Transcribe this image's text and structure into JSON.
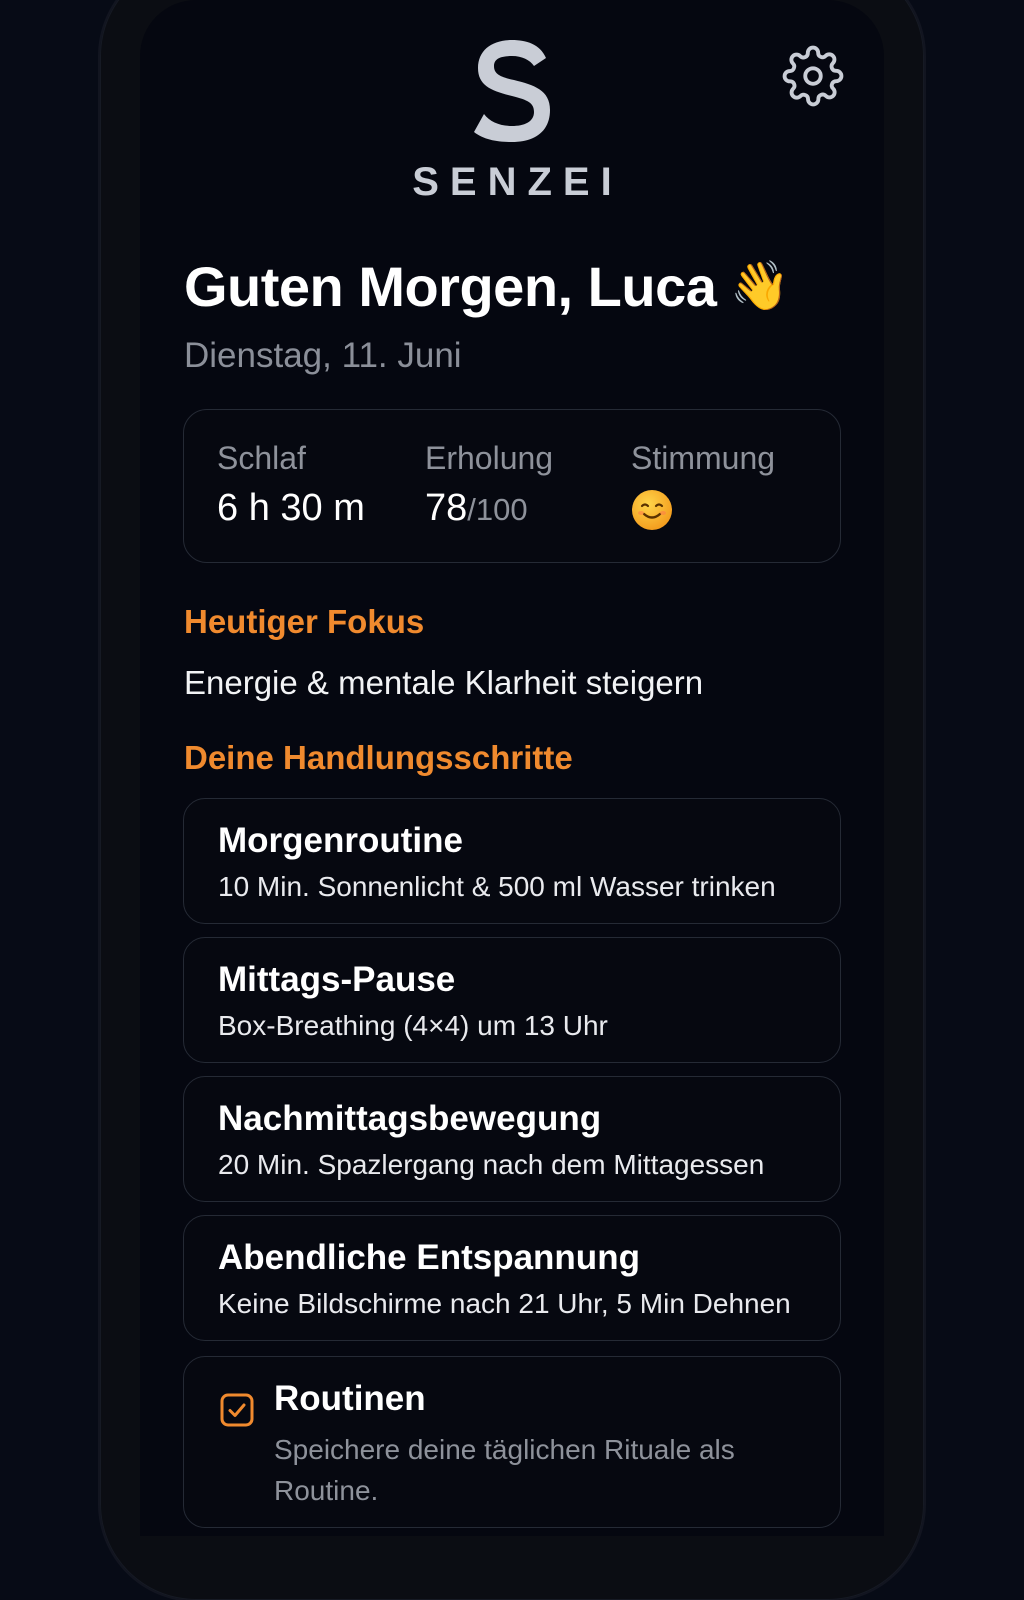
{
  "app": {
    "logo_letter": "S",
    "brand_name": "SENZEI"
  },
  "header": {
    "settings_icon": "gear-icon"
  },
  "greeting": {
    "text": "Guten Morgen, Luca",
    "emoji": "👋",
    "date": "Dienstag, 11. Juni"
  },
  "stats": {
    "sleep_label": "Schlaf",
    "sleep_value": "6 h 30 m",
    "recovery_label": "Erholung",
    "recovery_value": "78",
    "recovery_max": "/100",
    "mood_label": "Stimmung",
    "mood_icon": "smiling-face-icon"
  },
  "focus": {
    "title": "Heutiger Fokus",
    "text": "Energie & mentale Klarheit steigern"
  },
  "steps": {
    "title": "Deine Handlungsschritte",
    "items": [
      {
        "title": "Morgenroutine",
        "desc": "10 Min. Sonnenlicht & 500 ml Wasser trinken"
      },
      {
        "title": "Mittags-Pause",
        "desc": "Box-Breathing (4×4) um 13 Uhr"
      },
      {
        "title": "Nachmittagsbewegung",
        "desc": "20 Min. Spazlergang nach dem Mittagessen"
      },
      {
        "title": "Abendliche Entspannung",
        "desc": "Keine Bildschirme nach 21 Uhr, 5 Min Dehnen"
      }
    ]
  },
  "routine": {
    "title": "Routinen",
    "desc": "Speichere deine täglichen Rituale als Routine.",
    "icon": "checkbox-checked-icon"
  },
  "colors": {
    "accent": "#f08a2e",
    "background": "#050710",
    "text_primary": "#ffffff",
    "text_secondary": "#8e929b",
    "card_border": "#252a35"
  }
}
